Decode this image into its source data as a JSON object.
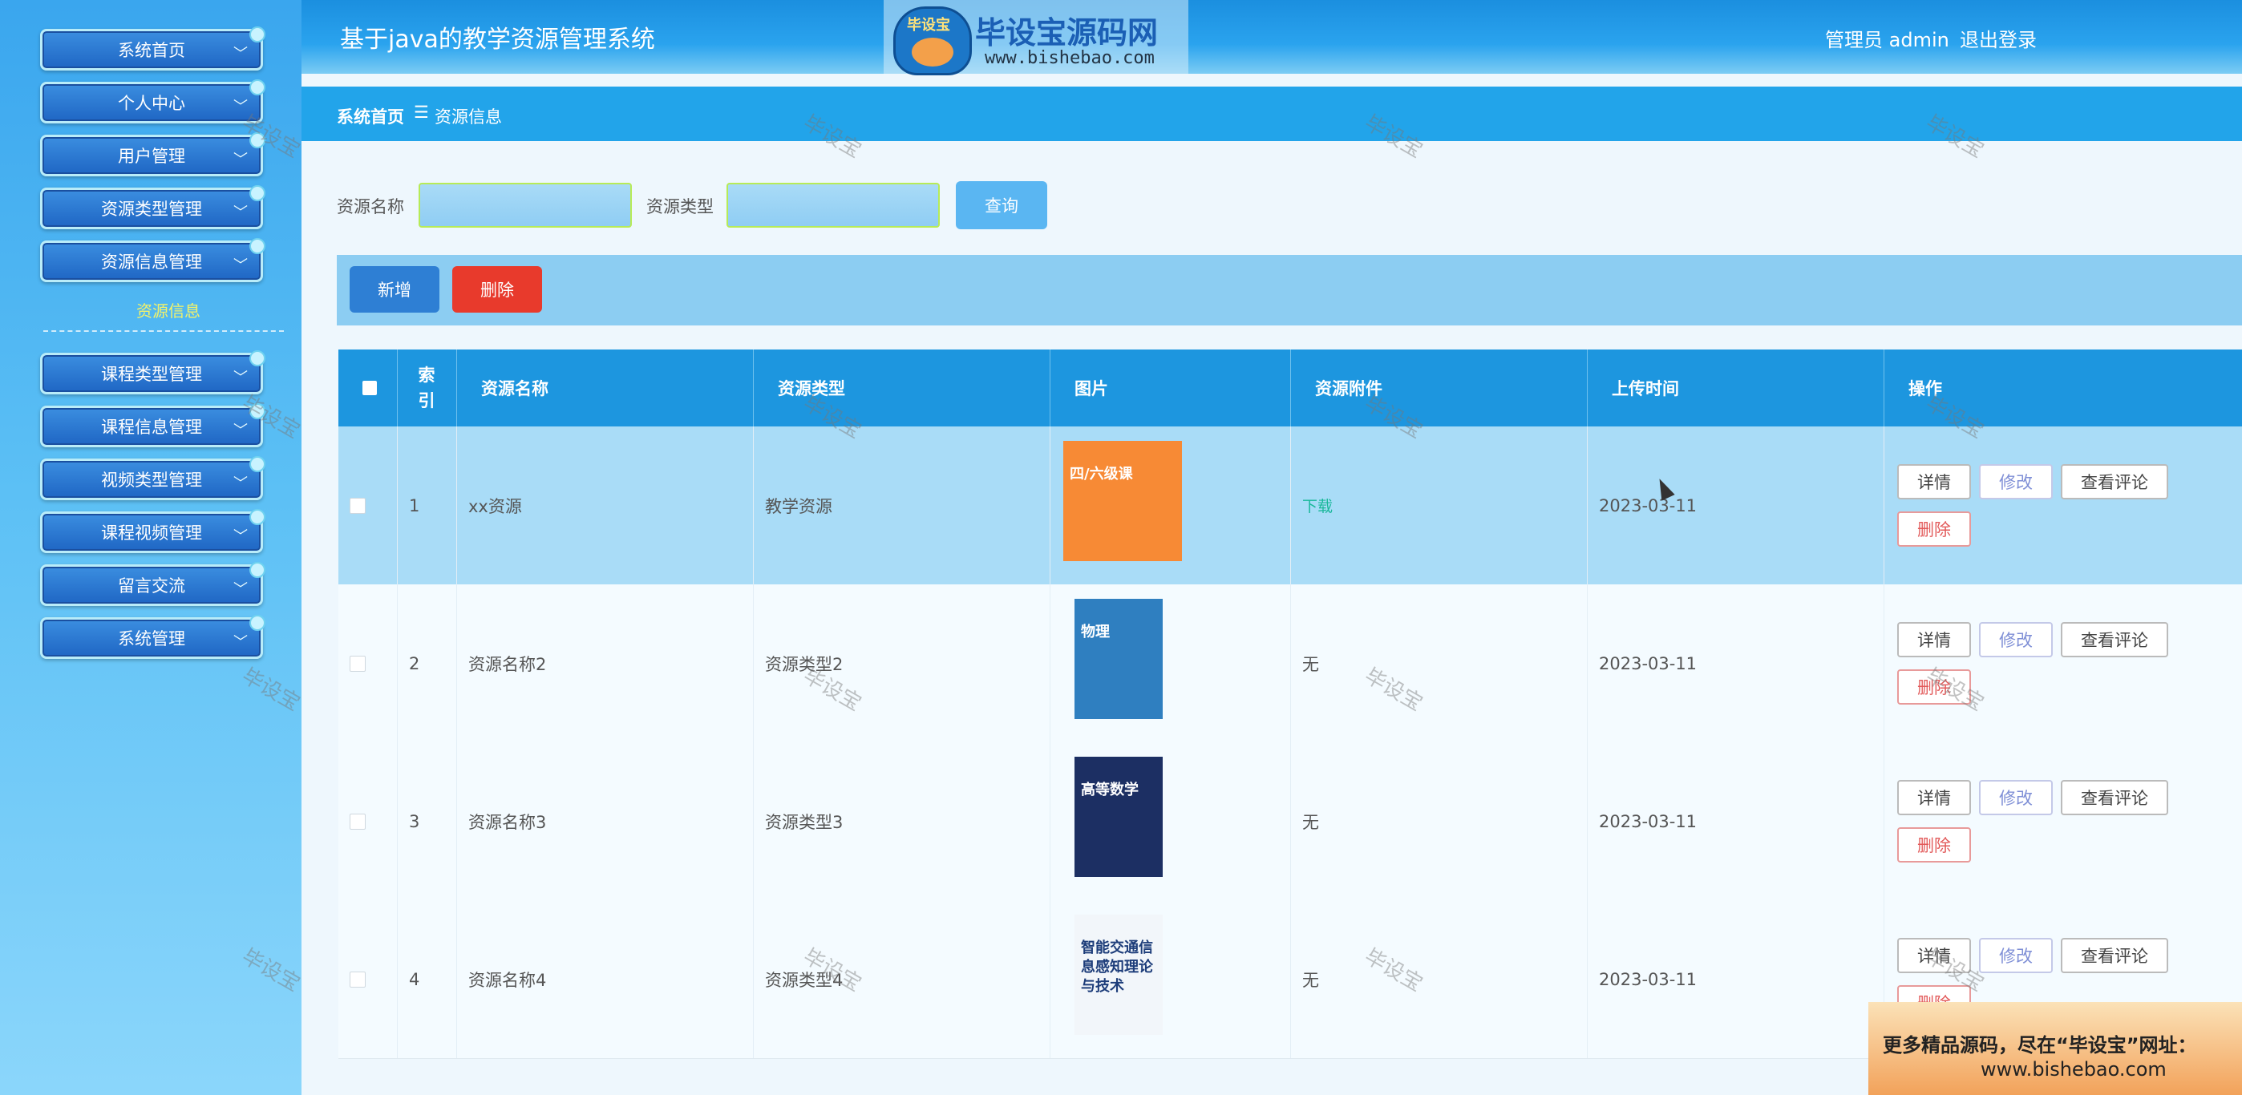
{
  "app": {
    "title": "基于java的教学资源管理系统",
    "user_label": "管理员 admin",
    "logout": "退出登录"
  },
  "logo": {
    "seal_text": "毕设宝",
    "name": "毕设宝源码网",
    "url": "www.bishebao.com"
  },
  "sidebar": {
    "items": [
      {
        "label": "系统首页"
      },
      {
        "label": "个人中心"
      },
      {
        "label": "用户管理"
      },
      {
        "label": "资源类型管理"
      },
      {
        "label": "资源信息管理"
      },
      {
        "label": "课程类型管理"
      },
      {
        "label": "课程信息管理"
      },
      {
        "label": "视频类型管理"
      },
      {
        "label": "课程视频管理"
      },
      {
        "label": "留言交流"
      },
      {
        "label": "系统管理"
      }
    ],
    "sub_item": "资源信息"
  },
  "breadcrumb": {
    "home": "系统首页",
    "separator": "☰",
    "current": "资源信息"
  },
  "search": {
    "name_label": "资源名称",
    "type_label": "资源类型",
    "name_value": "",
    "type_value": "",
    "query": "查询"
  },
  "actions": {
    "add": "新增",
    "delete": "删除"
  },
  "table": {
    "headers": [
      "",
      "索引",
      "资源名称",
      "资源类型",
      "图片",
      "资源附件",
      "上传时间",
      "操作"
    ],
    "rows": [
      {
        "index": "1",
        "name": "xx资源",
        "type": "教学资源",
        "attachment": "下载",
        "time": "2023-03-11"
      },
      {
        "index": "2",
        "name": "资源名称2",
        "type": "资源类型2",
        "attachment": "无",
        "time": "2023-03-11"
      },
      {
        "index": "3",
        "name": "资源名称3",
        "type": "资源类型3",
        "attachment": "无",
        "time": "2023-03-11"
      },
      {
        "index": "4",
        "name": "资源名称4",
        "type": "资源类型4",
        "attachment": "无",
        "time": "2023-03-11"
      }
    ],
    "ops": {
      "detail": "详情",
      "edit": "修改",
      "comments": "查看评论",
      "remove": "删除"
    }
  },
  "thumbs": [
    "四/六级课",
    "物理",
    "高等数学",
    "智能交通信息感知理论与技术"
  ],
  "watermark": "毕设宝",
  "promo": {
    "line1": "更多精品源码，尽在“毕设宝”网址：",
    "line2": "www.bishebao.com"
  }
}
